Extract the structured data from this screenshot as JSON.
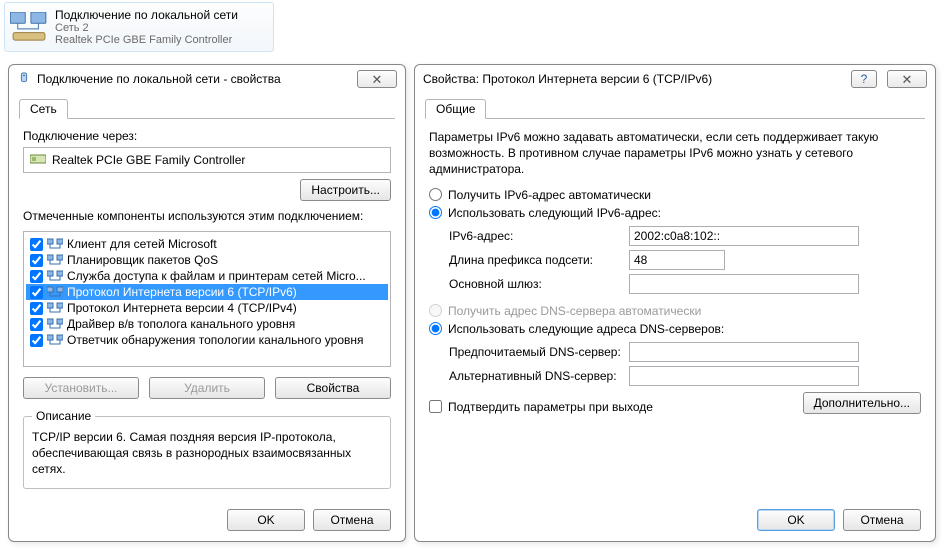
{
  "adapterTile": {
    "name": "Подключение по локальной сети",
    "network": "Сеть 2",
    "device": "Realtek PCIe GBE Family Controller"
  },
  "propsDialog": {
    "title": "Подключение по локальной сети - свойства",
    "tab": "Сеть",
    "connectLabel": "Подключение через:",
    "adapter": "Realtek PCIe GBE Family Controller",
    "configureBtn": "Настроить...",
    "componentsLabel": "Отмеченные компоненты используются этим подключением:",
    "components": [
      {
        "label": "Клиент для сетей Microsoft",
        "checked": true
      },
      {
        "label": "Планировщик пакетов QoS",
        "checked": true
      },
      {
        "label": "Служба доступа к файлам и принтерам сетей Micro...",
        "checked": true
      },
      {
        "label": "Протокол Интернета версии 6 (TCP/IPv6)",
        "checked": true,
        "selected": true
      },
      {
        "label": "Протокол Интернета версии 4 (TCP/IPv4)",
        "checked": true
      },
      {
        "label": "Драйвер в/в тополога канального уровня",
        "checked": true
      },
      {
        "label": "Ответчик обнаружения топологии канального уровня",
        "checked": true
      }
    ],
    "installBtn": "Установить...",
    "uninstallBtn": "Удалить",
    "propertiesBtn": "Свойства",
    "descLegend": "Описание",
    "descText": "TCP/IP версии 6. Самая поздняя версия IP-протокола, обеспечивающая связь в разнородных взаимосвязанных сетях.",
    "ok": "OK",
    "cancel": "Отмена"
  },
  "ipv6Dialog": {
    "title": "Свойства: Протокол Интернета версии 6 (TCP/IPv6)",
    "tab": "Общие",
    "intro": "Параметры IPv6 можно задавать автоматически, если сеть поддерживает такую возможность. В противном случае параметры IPv6 можно узнать у сетевого администратора.",
    "autoAddr": "Получить IPv6-адрес автоматически",
    "manualAddr": "Использовать следующий IPv6-адрес:",
    "addrLabel": "IPv6-адрес:",
    "addrValue": "2002:c0a8:102::",
    "prefixLabel": "Длина префикса подсети:",
    "prefixValue": "48",
    "gatewayLabel": "Основной шлюз:",
    "gatewayValue": "",
    "autoDns": "Получить адрес DNS-сервера автоматически",
    "manualDns": "Использовать следующие адреса DNS-серверов:",
    "dns1Label": "Предпочитаемый DNS-сервер:",
    "dns1Value": "",
    "dns2Label": "Альтернативный DNS-сервер:",
    "dns2Value": "",
    "validate": "Подтвердить параметры при выходе",
    "advanced": "Дополнительно...",
    "ok": "OK",
    "cancel": "Отмена"
  }
}
